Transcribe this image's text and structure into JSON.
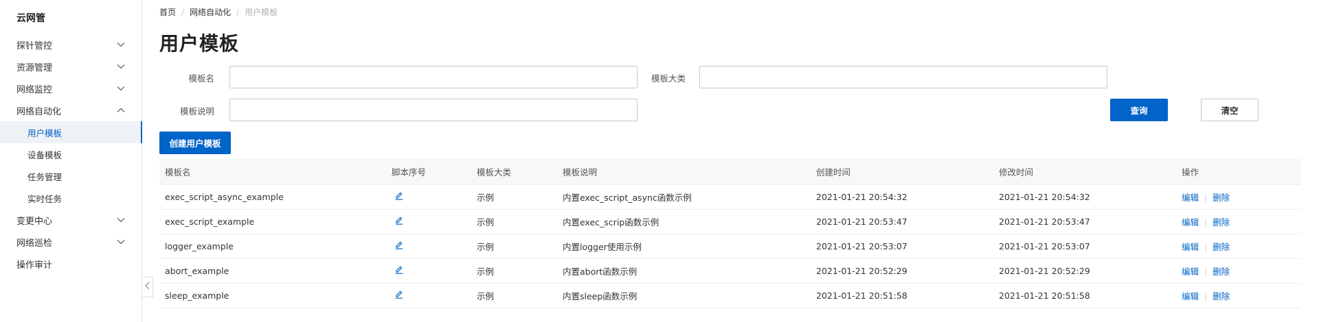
{
  "sidebar": {
    "brand": "云网管",
    "items": [
      {
        "label": "探针管控"
      },
      {
        "label": "资源管理"
      },
      {
        "label": "网络监控"
      },
      {
        "label": "网络自动化"
      },
      {
        "label": "变更中心"
      },
      {
        "label": "网络巡检"
      },
      {
        "label": "操作审计"
      }
    ],
    "sub_items": [
      {
        "label": "用户模板"
      },
      {
        "label": "设备模板"
      },
      {
        "label": "任务管理"
      },
      {
        "label": "实时任务"
      }
    ]
  },
  "breadcrumb": {
    "home": "首页",
    "section": "网络自动化",
    "current": "用户模板",
    "separator": "/"
  },
  "page_title": "用户模板",
  "filters": {
    "template_name_label": "模板名",
    "template_name_value": "",
    "template_category_label": "模板大类",
    "template_category_value": "",
    "template_desc_label": "模板说明",
    "template_desc_value": ""
  },
  "buttons": {
    "query": "查询",
    "clear": "清空",
    "create": "创建用户模板"
  },
  "table": {
    "headers": [
      "模板名",
      "脚本序号",
      "模板大类",
      "模板说明",
      "创建时间",
      "修改时间",
      "操作"
    ],
    "rows": [
      {
        "name": "exec_script_async_example",
        "category": "示例",
        "desc": "内置exec_script_async函数示例",
        "created": "2021-01-21 20:54:32",
        "modified": "2021-01-21 20:54:32"
      },
      {
        "name": "exec_script_example",
        "category": "示例",
        "desc": "内置exec_scrip函数示例",
        "created": "2021-01-21 20:53:47",
        "modified": "2021-01-21 20:53:47"
      },
      {
        "name": "logger_example",
        "category": "示例",
        "desc": "内置logger使用示例",
        "created": "2021-01-21 20:53:07",
        "modified": "2021-01-21 20:53:07"
      },
      {
        "name": "abort_example",
        "category": "示例",
        "desc": "内置abort函数示例",
        "created": "2021-01-21 20:52:29",
        "modified": "2021-01-21 20:52:29"
      },
      {
        "name": "sleep_example",
        "category": "示例",
        "desc": "内置sleep函数示例",
        "created": "2021-01-21 20:51:58",
        "modified": "2021-01-21 20:51:58"
      }
    ],
    "actions": {
      "edit": "编辑",
      "delete": "删除",
      "separator": "|"
    }
  },
  "colors": {
    "accent": "#0064c8",
    "sidebar_active_bg": "#eef1f5"
  },
  "icons": {
    "expand": "chevron-down-icon",
    "collapse": "chevron-up-icon",
    "script": "pencil-icon",
    "sidebar_toggle": "chevron-left-icon"
  }
}
